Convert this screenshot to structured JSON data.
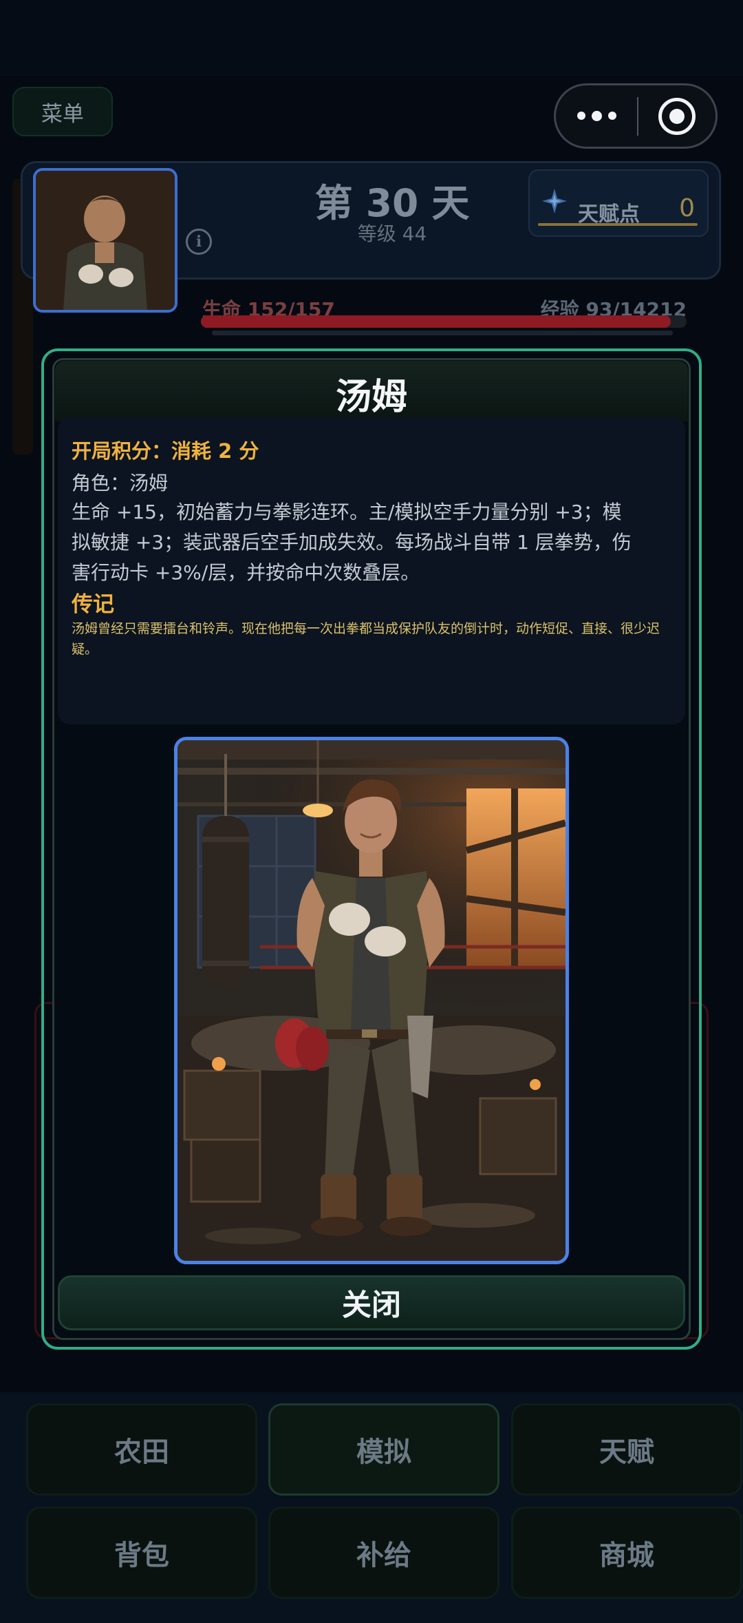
{
  "top_bar": {
    "menu_label": "菜单"
  },
  "status": {
    "day_title": "第 30 天",
    "level": "等级 44",
    "talent_label": "天赋点",
    "talent_value": "0",
    "hp_label": "生命 152/157",
    "exp_label": "经验 93/14212",
    "hp_fraction": 0.968,
    "exp_fraction": 0.0065
  },
  "modal": {
    "title": "汤姆",
    "score_line": "开局积分：消耗 2 分",
    "role_line": "角色：汤姆",
    "effect_text": "生命 +15，初始蓄力与拳影连环。主/模拟空手力量分别 +3；模拟敏捷 +3；装武器后空手加成失效。每场战斗自带 1 层拳势，伤害行动卡 +3%/层，并按命中次数叠层。",
    "bio_title": "传记",
    "bio_text": "汤姆曾经只需要擂台和铃声。现在他把每一次出拳都当成保护队友的倒计时，动作短促、直接、很少迟疑。",
    "close_label": "关闭"
  },
  "nav": {
    "items": [
      "农田",
      "模拟",
      "天赋",
      "背包",
      "补给",
      "商城"
    ],
    "active_index": 1
  },
  "colors": {
    "accent_green": "#2fae87",
    "gold": "#f0b23e",
    "portrait_border": "#4b82e8",
    "hp_red": "#8e1a24"
  }
}
